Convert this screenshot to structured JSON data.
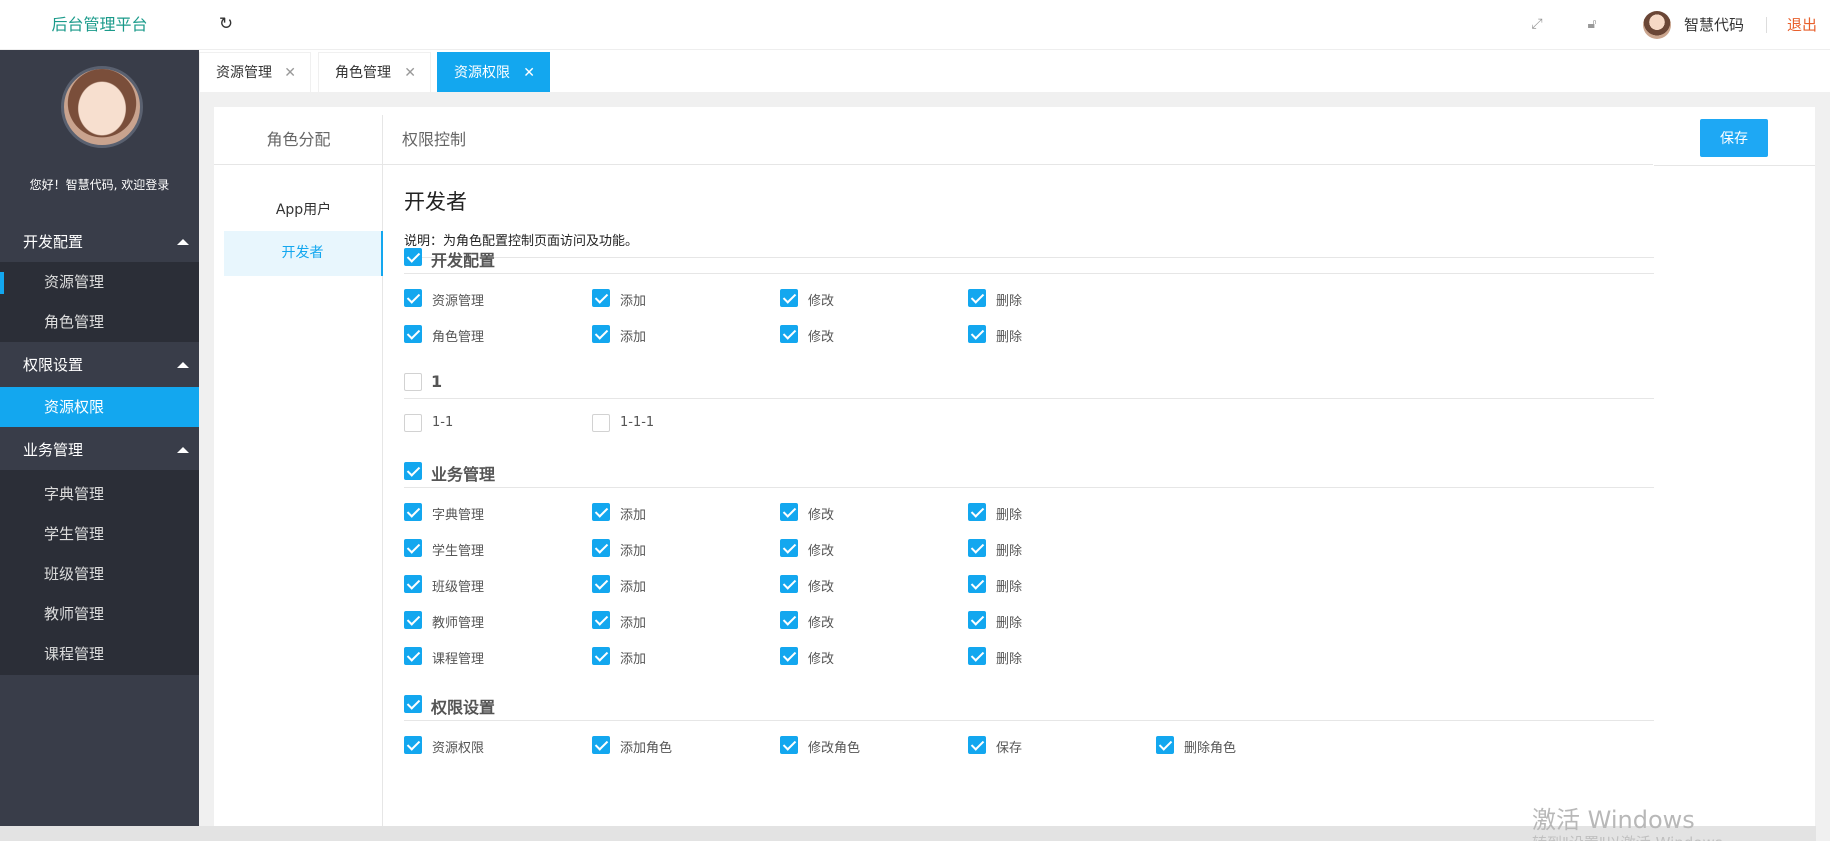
{
  "header": {
    "logo": "后台管理平台",
    "refresh_icon": "refresh-icon",
    "fullscreen_icon": "fullscreen-icon",
    "lock_icon": "lock-icon",
    "user_name": "智慧代码",
    "logout": "退出"
  },
  "sidebar": {
    "welcome": "您好！智慧代码, 欢迎登录",
    "groups": [
      {
        "label": "开发配置",
        "items": [
          "资源管理",
          "角色管理"
        ]
      },
      {
        "label": "权限设置",
        "items": [
          "资源权限"
        ]
      },
      {
        "label": "业务管理",
        "items": [
          "字典管理",
          "学生管理",
          "班级管理",
          "教师管理",
          "课程管理"
        ]
      }
    ]
  },
  "tabs": [
    {
      "label": "资源管理",
      "active": false
    },
    {
      "label": "角色管理",
      "active": false
    },
    {
      "label": "资源权限",
      "active": true
    }
  ],
  "role_panel": {
    "title": "角色分配",
    "roles": [
      {
        "label": "App用户",
        "active": false
      },
      {
        "label": "开发者",
        "active": true
      }
    ]
  },
  "permission_panel": {
    "title": "权限控制",
    "save_label": "保存",
    "role_title": "开发者",
    "description": "说明：为角色配置控制页面访问及功能。",
    "groups": [
      {
        "label": "开发配置",
        "checked": true,
        "rows": [
          [
            {
              "label": "资源管理",
              "checked": true
            },
            {
              "label": "添加",
              "checked": true
            },
            {
              "label": "修改",
              "checked": true
            },
            {
              "label": "删除",
              "checked": true
            }
          ],
          [
            {
              "label": "角色管理",
              "checked": true
            },
            {
              "label": "添加",
              "checked": true
            },
            {
              "label": "修改",
              "checked": true
            },
            {
              "label": "删除",
              "checked": true
            }
          ]
        ]
      },
      {
        "label": "1",
        "checked": false,
        "rows": [
          [
            {
              "label": "1-1",
              "checked": false
            },
            {
              "label": "1-1-1",
              "checked": false
            }
          ]
        ]
      },
      {
        "label": "业务管理",
        "checked": true,
        "rows": [
          [
            {
              "label": "字典管理",
              "checked": true
            },
            {
              "label": "添加",
              "checked": true
            },
            {
              "label": "修改",
              "checked": true
            },
            {
              "label": "删除",
              "checked": true
            }
          ],
          [
            {
              "label": "学生管理",
              "checked": true
            },
            {
              "label": "添加",
              "checked": true
            },
            {
              "label": "修改",
              "checked": true
            },
            {
              "label": "删除",
              "checked": true
            }
          ],
          [
            {
              "label": "班级管理",
              "checked": true
            },
            {
              "label": "添加",
              "checked": true
            },
            {
              "label": "修改",
              "checked": true
            },
            {
              "label": "删除",
              "checked": true
            }
          ],
          [
            {
              "label": "教师管理",
              "checked": true
            },
            {
              "label": "添加",
              "checked": true
            },
            {
              "label": "修改",
              "checked": true
            },
            {
              "label": "删除",
              "checked": true
            }
          ],
          [
            {
              "label": "课程管理",
              "checked": true
            },
            {
              "label": "添加",
              "checked": true
            },
            {
              "label": "修改",
              "checked": true
            },
            {
              "label": "删除",
              "checked": true
            }
          ]
        ]
      },
      {
        "label": "权限设置",
        "checked": true,
        "rows": [
          [
            {
              "label": "资源权限",
              "checked": true
            },
            {
              "label": "添加角色",
              "checked": true
            },
            {
              "label": "修改角色",
              "checked": true
            },
            {
              "label": "保存",
              "checked": true
            },
            {
              "label": "删除角色",
              "checked": true
            }
          ]
        ]
      }
    ]
  },
  "watermark": {
    "line1": "激活 Windows",
    "line2": "转到\"设置\"以激活 Windows。"
  },
  "colors": {
    "accent": "#13a7ef",
    "sidebar_bg": "#393d49",
    "sidebar_sub_bg": "#2b2e37",
    "logo": "#1a9a8a",
    "logout": "#e8602c"
  }
}
